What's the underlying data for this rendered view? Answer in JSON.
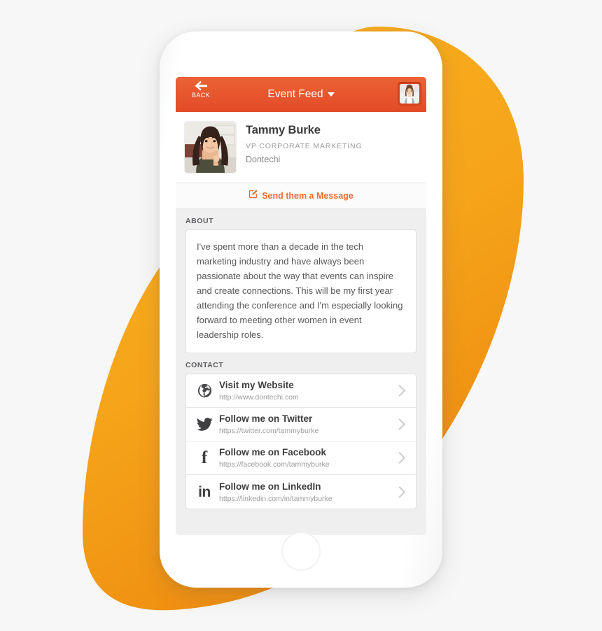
{
  "theme": {
    "canvas_bg": "#f7f7f7",
    "blob_color": "#f7a81b",
    "blob_color_deep": "#ef8c12",
    "nav_bar_top": "#ec6236",
    "nav_bar_bottom": "#e24b27",
    "accent_orange": "#ef6d2e",
    "screen_bg": "#efeff0"
  },
  "navbar": {
    "back_label": "BACK",
    "back_icon": "arrow-left-icon",
    "title": "Event Feed",
    "title_caret_icon": "caret-down-icon",
    "avatar_icon": "user-avatar-thumbnail"
  },
  "profile": {
    "photo_icon": "profile-photo",
    "name": "Tammy Burke",
    "role": "VP CORPORATE MARKETING",
    "company": "Dontechi"
  },
  "message_bar": {
    "icon": "compose-message-icon",
    "label": "Send them a Message"
  },
  "about": {
    "section_title": "ABOUT",
    "text": "I've spent more than a decade in the tech marketing industry and have always been passionate about the way that events can inspire and create connections. This will be my first year attending the conference and I'm especially looking forward to meeting other women in event leadership roles."
  },
  "contact": {
    "section_title": "CONTACT",
    "chevron_icon": "chevron-right-icon",
    "rows": [
      {
        "icon": "globe-icon",
        "title": "Visit my Website",
        "url": "http://www.dontechi.com"
      },
      {
        "icon": "twitter-icon",
        "title": "Follow me on Twitter",
        "url": "https://twitter.com/tammyburke"
      },
      {
        "icon": "facebook-icon",
        "glyph": "f",
        "title": "Follow me on Facebook",
        "url": "https://facebook.com/tammyburke"
      },
      {
        "icon": "linkedin-icon",
        "glyph": "in",
        "title": "Follow me on LinkedIn",
        "url": "https://linkedin.com/in/tammyburke"
      }
    ]
  },
  "device": {
    "speaker_icon": "earpiece-speaker",
    "camera_icon": "front-camera",
    "home_button_icon": "home-button"
  }
}
